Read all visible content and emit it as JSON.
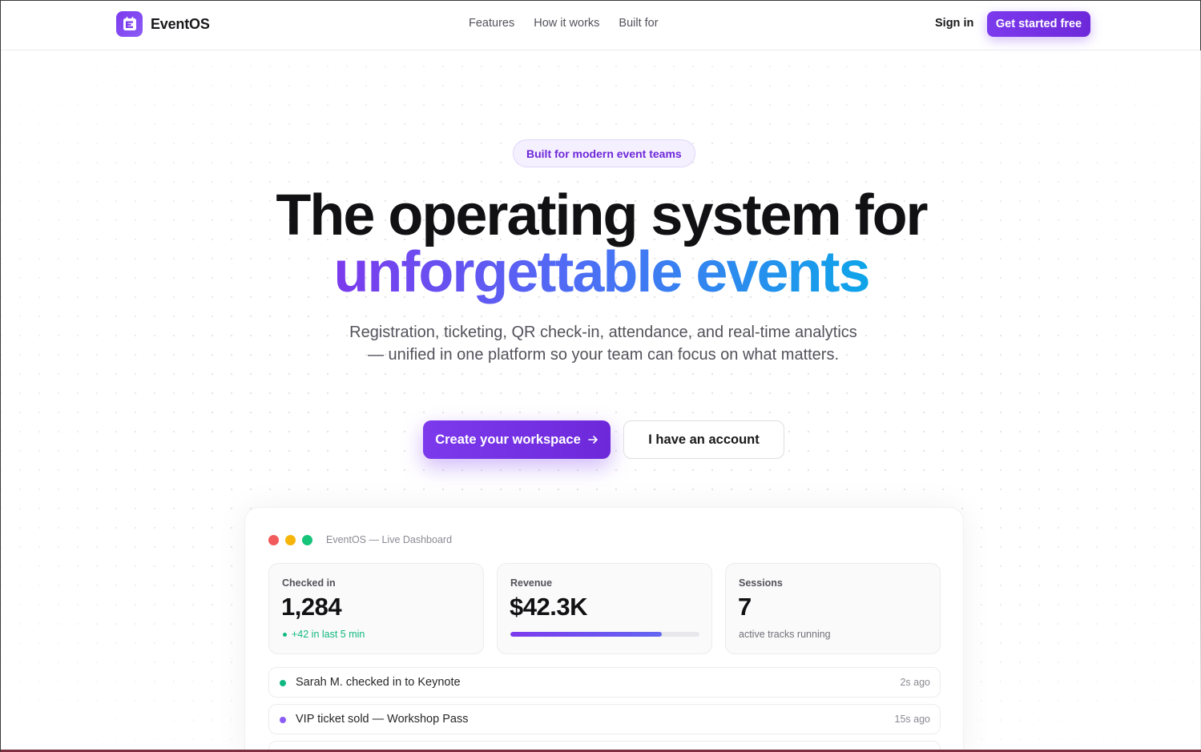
{
  "nav": {
    "brand": "EventOS",
    "links": [
      "Features",
      "How it works",
      "Built for"
    ],
    "signin": "Sign in",
    "cta": "Get started free"
  },
  "hero": {
    "badge": "Built for modern event teams",
    "title_line1": "The operating system for",
    "title_line2": "unforgettable events",
    "subtitle": "Registration, ticketing, QR check-in, attendance, and real-time analytics — unified in one platform so your team can focus on what matters.",
    "primary_cta": "Create your workspace",
    "secondary_cta": "I have an account"
  },
  "dashboard": {
    "window_title": "EventOS — Live Dashboard",
    "cards": [
      {
        "label": "Checked in",
        "value": "1,284",
        "note": "+42 in last 5 min"
      },
      {
        "label": "Revenue",
        "value": "$42.3K",
        "progress": 0.8
      },
      {
        "label": "Sessions",
        "value": "7",
        "note": "active tracks running"
      }
    ],
    "feed": [
      {
        "text": "Sarah M. checked in to Keynote",
        "time": "2s ago",
        "color": "#10b981"
      },
      {
        "text": "VIP ticket sold — Workshop Pass",
        "time": "15s ago",
        "color": "#8b5cf6"
      }
    ]
  },
  "colors": {
    "accent": "#7c3aed",
    "gradient_end": "#0ea5e9",
    "success": "#10b981"
  },
  "icons": [
    "calendar-logo-icon",
    "arrow-right-icon"
  ]
}
